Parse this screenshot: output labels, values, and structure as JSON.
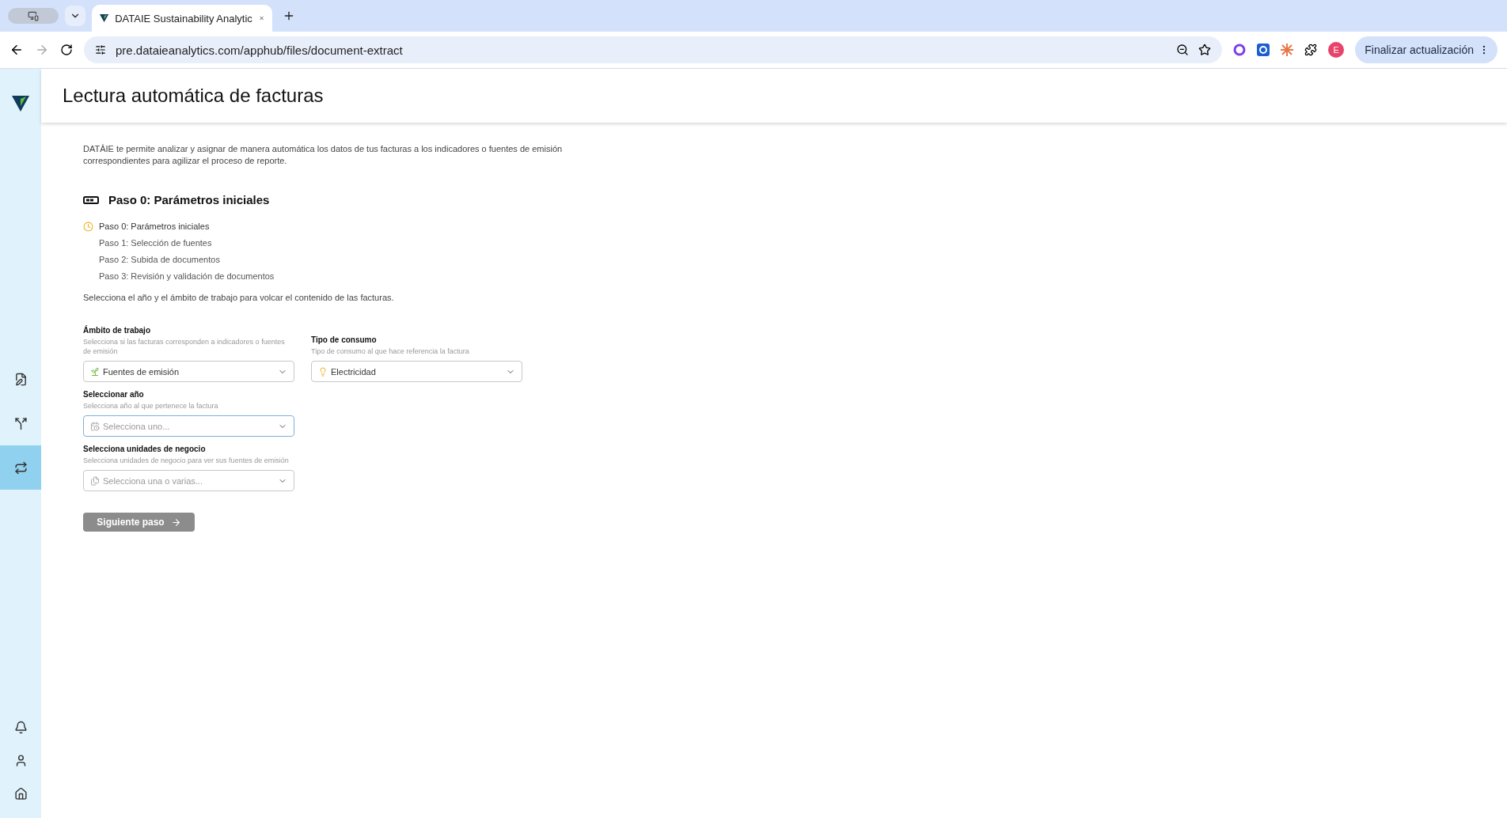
{
  "browser": {
    "tab_title": "DATAIE Sustainability Analytic",
    "address": "pre.dataieanalytics.com/apphub/files/document-extract",
    "profile_initial": "E",
    "update_button": "Finalizar actualización"
  },
  "sidebar": {
    "items": [
      {
        "kind": "document",
        "selected": false
      },
      {
        "kind": "branch",
        "selected": false
      },
      {
        "kind": "switch",
        "selected": true
      }
    ]
  },
  "page": {
    "title": "Lectura automática de facturas",
    "description": "DATÂIE te permite analizar y asignar de manera automática los datos de tus facturas a los indicadores o fuentes de emisión correspondientes para agilizar el proceso de reporte.",
    "step_heading": "Paso 0: Parámetros iniciales",
    "steps": [
      {
        "label": "Paso 0: Parámetros iniciales",
        "selected": true
      },
      {
        "label": "Paso 1: Selección de fuentes",
        "selected": false
      },
      {
        "label": "Paso 2: Subida de documentos",
        "selected": false
      },
      {
        "label": "Paso 3: Revisión y validación de documentos",
        "selected": false
      }
    ],
    "instruction": "Selecciona el año y el ámbito de trabajo para volcar el contenido de las facturas.",
    "fields": [
      {
        "kind": "scope",
        "label": "Ámbito de trabajo",
        "hint": "Selecciona si las facturas corresponden a indicadores o fuentes de emisión",
        "value": "Fuentes de emisión",
        "focused": false
      },
      {
        "kind": "consumption",
        "label": "Tipo de consumo",
        "hint": "Tipo de consumo al que hace referencia la factura",
        "value": "Electricidad",
        "focused": false
      },
      {
        "kind": "year",
        "label": "Seleccionar año",
        "hint": "Selecciona año al que pertenece la factura",
        "placeholder": "Selecciona uno...",
        "focused": true
      },
      {
        "kind": "units",
        "label": "Selecciona unidades de negocio",
        "hint": "Selecciona unidades de negocio para ver sus fuentes de emisión",
        "placeholder": "Selecciona una o varias...",
        "focused": false
      }
    ],
    "next_button": {
      "label": "Siguiente paso",
      "disabled": true
    }
  }
}
